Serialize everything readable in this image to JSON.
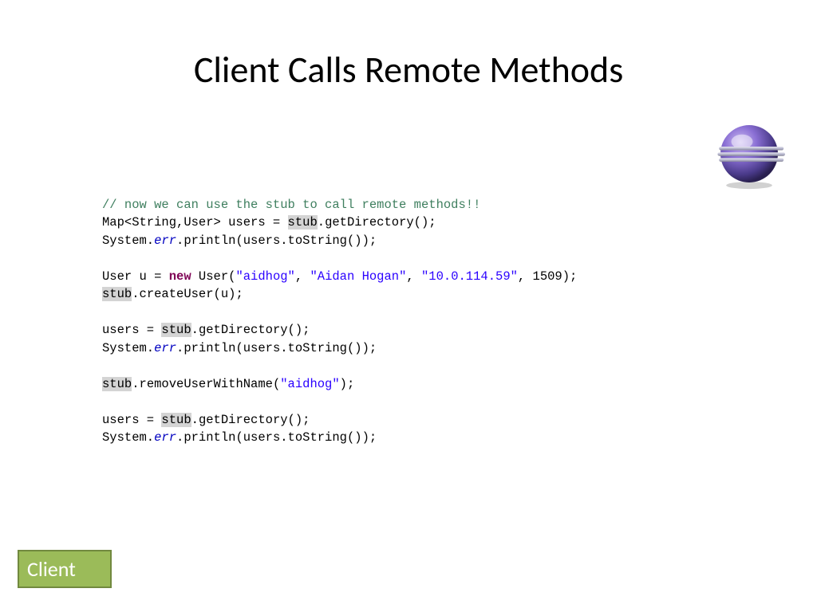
{
  "title": "Client Calls Remote Methods",
  "badge": "Client",
  "code": {
    "c1": "// now we can use the stub to call remote methods!!",
    "l2a": "Map<String,User> users = ",
    "stub": "stub",
    "l2b": ".getDirectory();",
    "l3a": "System.",
    "err": "err",
    "l3b": ".println(users.toString());",
    "l5a": "User u = ",
    "new": "new",
    "l5b": " User(",
    "s1": "\"aidhog\"",
    "s2": "\"Aidan Hogan\"",
    "s3": "\"10.0.114.59\"",
    "n1": "1509",
    "l5c": ");",
    "l6": ".createUser(u);",
    "l8a": "users = ",
    "l11": ".removeUserWithName(",
    "comma": ", "
  }
}
